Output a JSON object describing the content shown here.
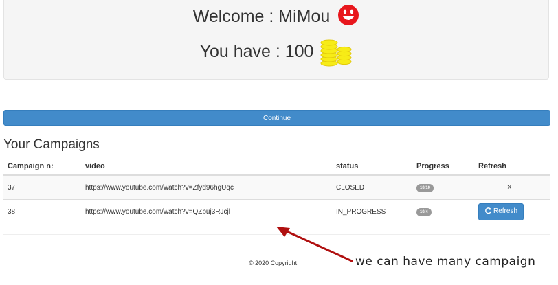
{
  "welcome": {
    "greeting": "Welcome : MiMou",
    "coins_text": "You have : 100"
  },
  "continue_label": "Continue",
  "section_title": "Your Campaigns",
  "table": {
    "headers": [
      "Campaign n:",
      "video",
      "status",
      "Progress",
      "Refresh"
    ],
    "rows": [
      {
        "n": "37",
        "video": "https://www.youtube.com/watch?v=Zfyd96hgUqc",
        "status": "CLOSED",
        "progress": "10/10",
        "refresh": "×"
      },
      {
        "n": "38",
        "video": "https://www.youtube.com/watch?v=QZbuj3RJcjl",
        "status": "IN_PROGRESS",
        "progress": "10/4",
        "refresh": "Refresh"
      }
    ]
  },
  "footer": {
    "copyright": "© 2020 Copyright"
  },
  "annotation": {
    "text": "we can have many campaign"
  },
  "colors": {
    "primary": "#428bca",
    "smiley": "#e8171d",
    "coin": "#f7ec17",
    "arrow": "#b01010",
    "badge": "#999999"
  },
  "icons": [
    "smiley-icon",
    "coins-icon",
    "refresh-icon",
    "close-icon",
    "arrow"
  ]
}
